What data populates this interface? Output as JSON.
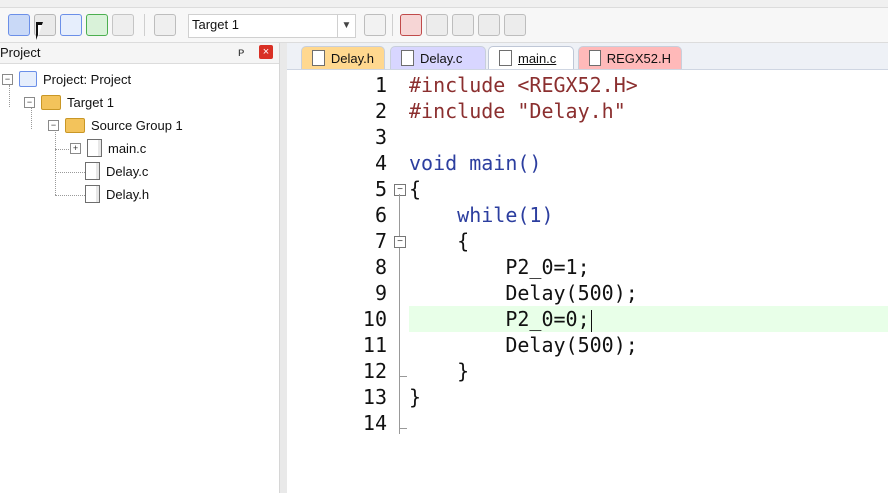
{
  "toolbar": {
    "target_label": "Target 1",
    "icons": [
      "download-icon",
      "build-icon",
      "rebuild-icon",
      "batch-build-icon",
      "stop-build-icon",
      "load-icon",
      "target-dropdown-icon",
      "wand-icon",
      "options-icon",
      "manage-icon",
      "settings-icon",
      "tool-icon",
      "layout-icon"
    ]
  },
  "project_panel": {
    "title": "Project",
    "pin_label": "ᴘ",
    "close_label": "×",
    "tree": {
      "project": "Project: Project",
      "target": "Target 1",
      "group": "Source Group 1",
      "files": [
        "main.c",
        "Delay.c",
        "Delay.h"
      ]
    }
  },
  "tabs": [
    {
      "label": "Delay.h"
    },
    {
      "label": "Delay.c"
    },
    {
      "label": "main.c",
      "active": true
    },
    {
      "label": "REGX52.H"
    }
  ],
  "editor": {
    "lines": [
      {
        "n": "1",
        "code": "#include <REGX52.H>"
      },
      {
        "n": "2",
        "code": "#include \"Delay.h\""
      },
      {
        "n": "3",
        "code": ""
      },
      {
        "n": "4",
        "code": "void main()"
      },
      {
        "n": "5",
        "code": "{"
      },
      {
        "n": "6",
        "code": "    while(1)"
      },
      {
        "n": "7",
        "code": "    {"
      },
      {
        "n": "8",
        "code": "        P2_0=1;"
      },
      {
        "n": "9",
        "code": "        Delay(500);"
      },
      {
        "n": "10",
        "code": "        P2_0=0;"
      },
      {
        "n": "11",
        "code": "        Delay(500);"
      },
      {
        "n": "12",
        "code": "    }"
      },
      {
        "n": "13",
        "code": "}"
      },
      {
        "n": "14",
        "code": ""
      }
    ],
    "highlighted_line": "10"
  },
  "colors": {
    "highlight": "#e8ffe8",
    "tab_delay_h": "#ffd88f",
    "tab_delay_c": "#d8d6ff",
    "tab_regx52": "#ffb9b9",
    "keyword": "#2c3e9f",
    "number": "#2e8b8b",
    "preprocessor": "#8b2f2f"
  }
}
